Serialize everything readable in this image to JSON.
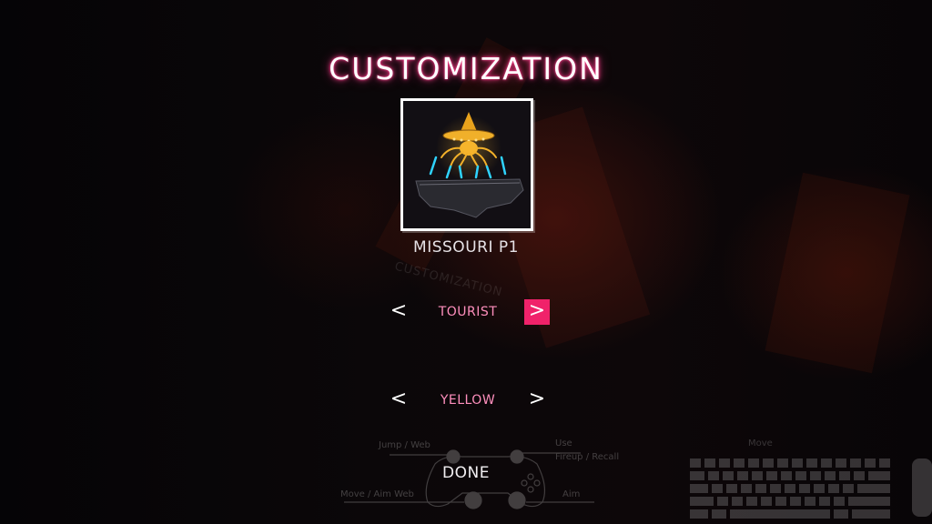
{
  "screen": {
    "title": "CUSTOMIZATION",
    "character_name": "MISSOURI P1"
  },
  "selectors": [
    {
      "value": "TOURIST",
      "left_label": "<",
      "right_label": ">",
      "right_highlighted": true
    },
    {
      "value": "YELLOW",
      "left_label": "<",
      "right_label": ">",
      "right_highlighted": false
    }
  ],
  "done_label": "DONE",
  "background_hints": {
    "ghost_title": "CUSTOMIZATION",
    "jump_web": "Jump / Web",
    "use": "Use",
    "fireup_recall": "Fireup / Recall",
    "move_aim_web": "Move / Aim Web",
    "aim": "Aim",
    "move": "Move"
  },
  "colors": {
    "accent_pink": "#f0226a",
    "title_glow": "#ff3d8b",
    "value_text": "#ff8fbd"
  }
}
